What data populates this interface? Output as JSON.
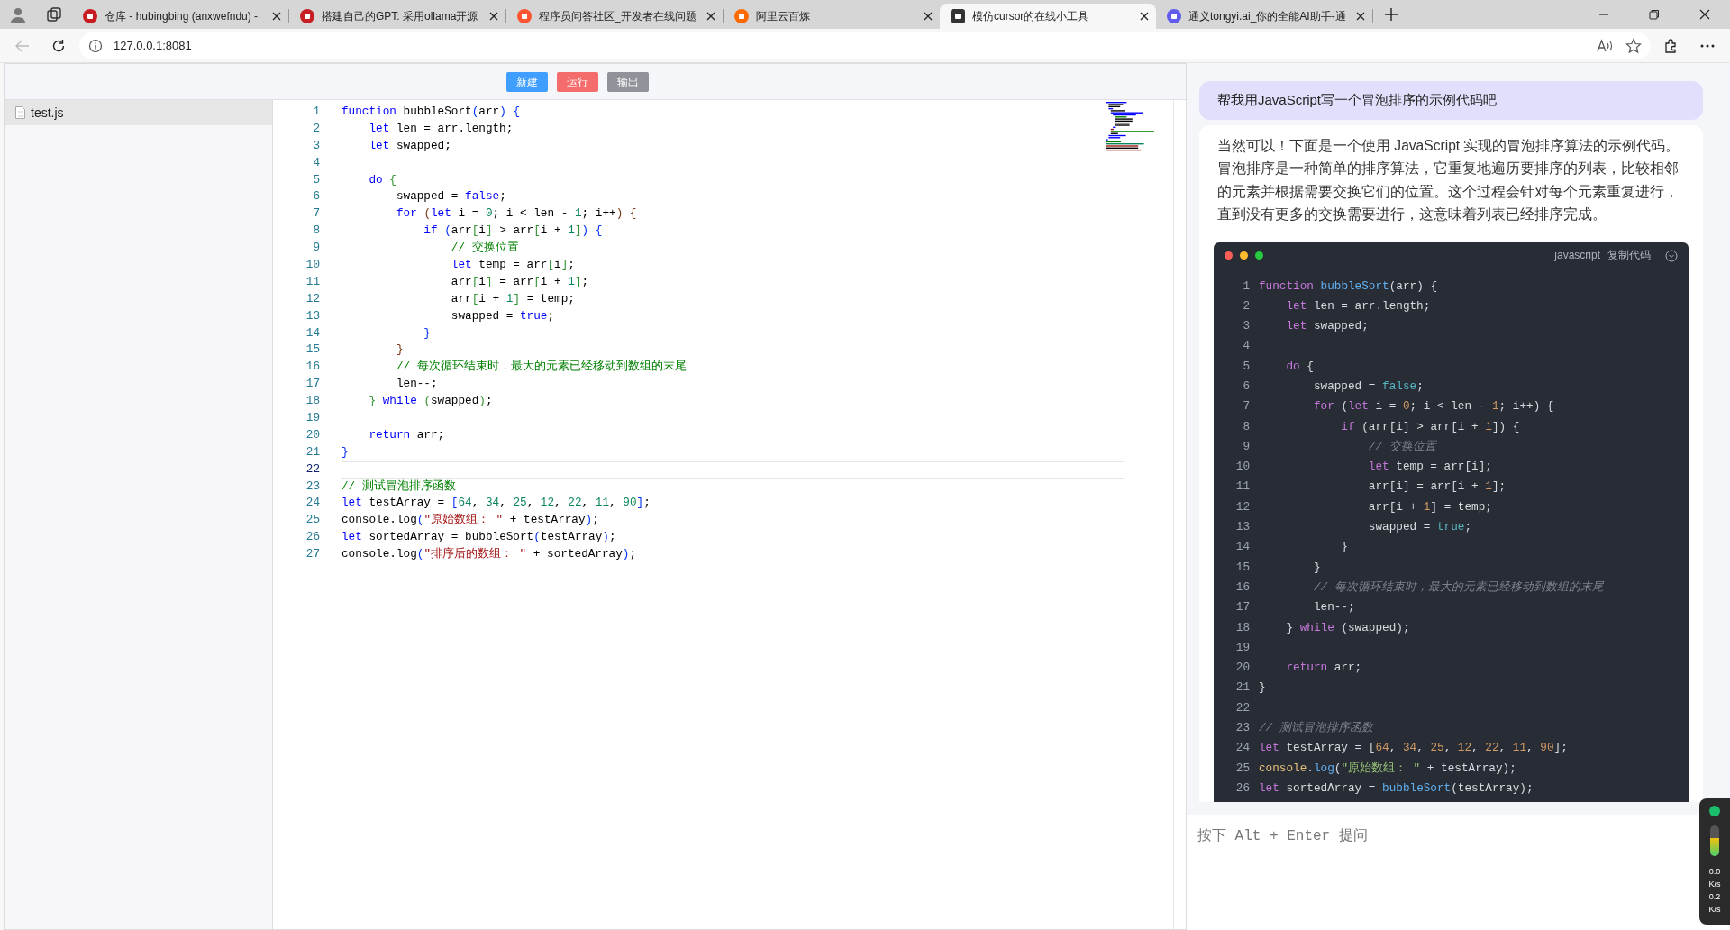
{
  "browser": {
    "tabs": [
      {
        "title": "仓库 - hubingbing (anxwefndu) -",
        "color": "#c71d23",
        "selected": false
      },
      {
        "title": "搭建自己的GPT: 采用ollama开源",
        "color": "#c71d23",
        "selected": false
      },
      {
        "title": "程序员问答社区_开发者在线问题",
        "color": "#fc5531",
        "selected": false
      },
      {
        "title": "阿里云百炼",
        "color": "#ff6a00",
        "selected": false
      },
      {
        "title": "模仿cursor的在线小工具",
        "color": "#333333",
        "selected": true
      },
      {
        "title": "通义tongyi.ai_你的全能AI助手-通",
        "color": "#615ced",
        "selected": false
      }
    ],
    "url": "127.0.0.1:8081"
  },
  "toolbar": {
    "buttons": [
      {
        "label": "新建",
        "color": "#409eff"
      },
      {
        "label": "运行",
        "color": "#f56c6c"
      },
      {
        "label": "输出",
        "color": "#909399"
      }
    ]
  },
  "files": [
    {
      "name": "test.js",
      "selected": true
    }
  ],
  "editor": {
    "lines": [
      {
        "n": "1",
        "current": false,
        "code": [
          {
            "kind": "kw",
            "text": "function"
          },
          {
            "kind": "id",
            "text": " bubbleSort"
          },
          {
            "kind": "br1",
            "text": "("
          },
          {
            "kind": "id",
            "text": "arr"
          },
          {
            "kind": "br1",
            "text": ")"
          },
          {
            "kind": "br1",
            "text": " {"
          }
        ]
      },
      {
        "n": "2",
        "current": false,
        "code": [
          {
            "kind": "kw",
            "text": "    let"
          },
          {
            "kind": "id",
            "text": " len = arr.length;"
          }
        ]
      },
      {
        "n": "3",
        "current": false,
        "code": [
          {
            "kind": "kw",
            "text": "    let"
          },
          {
            "kind": "id",
            "text": " swapped;"
          }
        ]
      },
      {
        "n": "4",
        "current": false
      },
      {
        "n": "5",
        "current": false,
        "code": [
          {
            "kind": "kw",
            "text": "    do"
          },
          {
            "kind": "br2",
            "text": " {"
          }
        ]
      },
      {
        "n": "6",
        "current": false,
        "code": [
          {
            "kind": "id",
            "text": "        swapped = "
          },
          {
            "kind": "kw",
            "text": "false"
          },
          {
            "kind": "id",
            "text": ";"
          }
        ]
      },
      {
        "n": "7",
        "current": false,
        "code": [
          {
            "kind": "kw",
            "text": "        for"
          },
          {
            "kind": "br3",
            "text": " ("
          },
          {
            "kind": "kw",
            "text": "let"
          },
          {
            "kind": "id",
            "text": " i = "
          },
          {
            "kind": "num",
            "text": "0"
          },
          {
            "kind": "id",
            "text": "; i < len - "
          },
          {
            "kind": "num",
            "text": "1"
          },
          {
            "kind": "id",
            "text": "; i++"
          },
          {
            "kind": "br3",
            "text": ")"
          },
          {
            "kind": "br3",
            "text": " {"
          }
        ]
      },
      {
        "n": "8",
        "current": false,
        "code": [
          {
            "kind": "kw",
            "text": "            if"
          },
          {
            "kind": "br1",
            "text": " ("
          },
          {
            "kind": "id",
            "text": "arr"
          },
          {
            "kind": "br2",
            "text": "["
          },
          {
            "kind": "id",
            "text": "i"
          },
          {
            "kind": "br2",
            "text": "]"
          },
          {
            "kind": "id",
            "text": " > arr"
          },
          {
            "kind": "br2",
            "text": "["
          },
          {
            "kind": "id",
            "text": "i + "
          },
          {
            "kind": "num",
            "text": "1"
          },
          {
            "kind": "br2",
            "text": "]"
          },
          {
            "kind": "br1",
            "text": ")"
          },
          {
            "kind": "br1",
            "text": " {"
          }
        ]
      },
      {
        "n": "9",
        "current": false,
        "code": [
          {
            "kind": "com",
            "text": "                // 交换位置"
          }
        ]
      },
      {
        "n": "10",
        "current": false,
        "code": [
          {
            "kind": "kw",
            "text": "                let"
          },
          {
            "kind": "id",
            "text": " temp = arr"
          },
          {
            "kind": "br2",
            "text": "["
          },
          {
            "kind": "id",
            "text": "i"
          },
          {
            "kind": "br2",
            "text": "]"
          },
          {
            "kind": "id",
            "text": ";"
          }
        ]
      },
      {
        "n": "11",
        "current": false,
        "code": [
          {
            "kind": "id",
            "text": "                arr"
          },
          {
            "kind": "br2",
            "text": "["
          },
          {
            "kind": "id",
            "text": "i"
          },
          {
            "kind": "br2",
            "text": "]"
          },
          {
            "kind": "id",
            "text": " = arr"
          },
          {
            "kind": "br2",
            "text": "["
          },
          {
            "kind": "id",
            "text": "i + "
          },
          {
            "kind": "num",
            "text": "1"
          },
          {
            "kind": "br2",
            "text": "]"
          },
          {
            "kind": "id",
            "text": ";"
          }
        ]
      },
      {
        "n": "12",
        "current": false,
        "code": [
          {
            "kind": "id",
            "text": "                arr"
          },
          {
            "kind": "br2",
            "text": "["
          },
          {
            "kind": "id",
            "text": "i + "
          },
          {
            "kind": "num",
            "text": "1"
          },
          {
            "kind": "br2",
            "text": "]"
          },
          {
            "kind": "id",
            "text": " = temp;"
          }
        ]
      },
      {
        "n": "13",
        "current": false,
        "code": [
          {
            "kind": "id",
            "text": "                swapped = "
          },
          {
            "kind": "kw",
            "text": "true"
          },
          {
            "kind": "id",
            "text": ";"
          }
        ]
      },
      {
        "n": "14",
        "current": false,
        "code": [
          {
            "kind": "br1",
            "text": "            }"
          }
        ]
      },
      {
        "n": "15",
        "current": false,
        "code": [
          {
            "kind": "br3",
            "text": "        }"
          }
        ]
      },
      {
        "n": "16",
        "current": false,
        "code": [
          {
            "kind": "com",
            "text": "        // 每次循环结束时，最大的元素已经移动到数组的末尾"
          }
        ]
      },
      {
        "n": "17",
        "current": false,
        "code": [
          {
            "kind": "id",
            "text": "        len--;"
          }
        ]
      },
      {
        "n": "18",
        "current": false,
        "code": [
          {
            "kind": "br2",
            "text": "    }"
          },
          {
            "kind": "kw",
            "text": " while"
          },
          {
            "kind": "br2",
            "text": " ("
          },
          {
            "kind": "id",
            "text": "swapped"
          },
          {
            "kind": "br2",
            "text": ")"
          },
          {
            "kind": "id",
            "text": ";"
          }
        ]
      },
      {
        "n": "19",
        "current": false
      },
      {
        "n": "20",
        "current": false,
        "code": [
          {
            "kind": "kw",
            "text": "    return"
          },
          {
            "kind": "id",
            "text": " arr;"
          }
        ]
      },
      {
        "n": "21",
        "current": false,
        "code": [
          {
            "kind": "br1",
            "text": "}"
          }
        ]
      },
      {
        "n": "22",
        "current": true
      },
      {
        "n": "23",
        "current": false,
        "code": [
          {
            "kind": "com",
            "text": "// 测试冒泡排序函数"
          }
        ]
      },
      {
        "n": "24",
        "current": false,
        "code": [
          {
            "kind": "kw",
            "text": "let"
          },
          {
            "kind": "id",
            "text": " testArray = "
          },
          {
            "kind": "br1",
            "text": "["
          },
          {
            "kind": "num",
            "text": "64"
          },
          {
            "kind": "id",
            "text": ", "
          },
          {
            "kind": "num",
            "text": "34"
          },
          {
            "kind": "id",
            "text": ", "
          },
          {
            "kind": "num",
            "text": "25"
          },
          {
            "kind": "id",
            "text": ", "
          },
          {
            "kind": "num",
            "text": "12"
          },
          {
            "kind": "id",
            "text": ", "
          },
          {
            "kind": "num",
            "text": "22"
          },
          {
            "kind": "id",
            "text": ", "
          },
          {
            "kind": "num",
            "text": "11"
          },
          {
            "kind": "id",
            "text": ", "
          },
          {
            "kind": "num",
            "text": "90"
          },
          {
            "kind": "br1",
            "text": "]"
          },
          {
            "kind": "id",
            "text": ";"
          }
        ]
      },
      {
        "n": "25",
        "current": false,
        "code": [
          {
            "kind": "id",
            "text": "console.log"
          },
          {
            "kind": "br1",
            "text": "("
          },
          {
            "kind": "str",
            "text": "\"原始数组： \""
          },
          {
            "kind": "id",
            "text": " + testArray"
          },
          {
            "kind": "br1",
            "text": ")"
          },
          {
            "kind": "id",
            "text": ";"
          }
        ]
      },
      {
        "n": "26",
        "current": false,
        "code": [
          {
            "kind": "kw",
            "text": "let"
          },
          {
            "kind": "id",
            "text": " sortedArray = "
          },
          {
            "kind": "id",
            "text": "bubbleSort"
          },
          {
            "kind": "br1",
            "text": "("
          },
          {
            "kind": "id",
            "text": "testArray"
          },
          {
            "kind": "br1",
            "text": ")"
          },
          {
            "kind": "id",
            "text": ";"
          }
        ]
      },
      {
        "n": "27",
        "current": false,
        "code": [
          {
            "kind": "id",
            "text": "console.log"
          },
          {
            "kind": "br1",
            "text": "("
          },
          {
            "kind": "str",
            "text": "\"排序后的数组： \""
          },
          {
            "kind": "id",
            "text": " + sortedArray"
          },
          {
            "kind": "br1",
            "text": ")"
          },
          {
            "kind": "id",
            "text": ";"
          }
        ]
      }
    ]
  },
  "chat": {
    "messages": [
      {
        "kind": "user",
        "text": "帮我用JavaScript写一个冒泡排序的示例代码吧"
      },
      {
        "kind": "assistant",
        "text": "当然可以！下面是一个使用 JavaScript 实现的冒泡排序算法的示例代码。冒泡排序是一种简单的排序算法，它重复地遍历要排序的列表，比较相邻的元素并根据需要交换它们的位置。这个过程会针对每个元素重复进行，直到没有更多的交换需要进行，这意味着列表已经排序完成。",
        "code": {
          "language": "javascript",
          "copy_label": "复制代码",
          "lines": [
            {
              "n": "1",
              "code": [
                {
                  "kind": "kw",
                  "text": "function"
                },
                {
                  "kind": "fn",
                  "text": " bubbleSort"
                },
                {
                  "kind": "id",
                  "text": "("
                },
                {
                  "kind": "id",
                  "text": "arr"
                },
                {
                  "kind": "id",
                  "text": ")"
                },
                {
                  "kind": "id",
                  "text": " {"
                }
              ]
            },
            {
              "n": "2",
              "code": [
                {
                  "kind": "kw",
                  "text": "    let"
                },
                {
                  "kind": "id",
                  "text": " len = arr.length;"
                }
              ]
            },
            {
              "n": "3",
              "code": [
                {
                  "kind": "kw",
                  "text": "    let"
                },
                {
                  "kind": "id",
                  "text": " swapped;"
                }
              ]
            },
            {
              "n": "4"
            },
            {
              "n": "5",
              "code": [
                {
                  "kind": "kw",
                  "text": "    do"
                },
                {
                  "kind": "id",
                  "text": " {"
                }
              ]
            },
            {
              "n": "6",
              "code": [
                {
                  "kind": "id",
                  "text": "        swapped = "
                },
                {
                  "kind": "bool",
                  "text": "false"
                },
                {
                  "kind": "id",
                  "text": ";"
                }
              ]
            },
            {
              "n": "7",
              "code": [
                {
                  "kind": "kw",
                  "text": "        for"
                },
                {
                  "kind": "id",
                  "text": " ("
                },
                {
                  "kind": "kw",
                  "text": "let"
                },
                {
                  "kind": "id",
                  "text": " i = "
                },
                {
                  "kind": "num",
                  "text": "0"
                },
                {
                  "kind": "id",
                  "text": "; i < len - "
                },
                {
                  "kind": "num",
                  "text": "1"
                },
                {
                  "kind": "id",
                  "text": "; i++"
                },
                {
                  "kind": "id",
                  "text": ")"
                },
                {
                  "kind": "id",
                  "text": " {"
                }
              ]
            },
            {
              "n": "8",
              "code": [
                {
                  "kind": "kw",
                  "text": "            if"
                },
                {
                  "kind": "id",
                  "text": " ("
                },
                {
                  "kind": "id",
                  "text": "arr"
                },
                {
                  "kind": "id",
                  "text": "["
                },
                {
                  "kind": "id",
                  "text": "i"
                },
                {
                  "kind": "id",
                  "text": "]"
                },
                {
                  "kind": "id",
                  "text": " > arr"
                },
                {
                  "kind": "id",
                  "text": "["
                },
                {
                  "kind": "id",
                  "text": "i + "
                },
                {
                  "kind": "num",
                  "text": "1"
                },
                {
                  "kind": "id",
                  "text": "]"
                },
                {
                  "kind": "id",
                  "text": ")"
                },
                {
                  "kind": "id",
                  "text": " {"
                }
              ]
            },
            {
              "n": "9",
              "code": [
                {
                  "kind": "com",
                  "text": "                // 交换位置"
                }
              ]
            },
            {
              "n": "10",
              "code": [
                {
                  "kind": "kw",
                  "text": "                let"
                },
                {
                  "kind": "id",
                  "text": " temp = arr"
                },
                {
                  "kind": "id",
                  "text": "["
                },
                {
                  "kind": "id",
                  "text": "i"
                },
                {
                  "kind": "id",
                  "text": "]"
                },
                {
                  "kind": "id",
                  "text": ";"
                }
              ]
            },
            {
              "n": "11",
              "code": [
                {
                  "kind": "id",
                  "text": "                arr"
                },
                {
                  "kind": "id",
                  "text": "["
                },
                {
                  "kind": "id",
                  "text": "i"
                },
                {
                  "kind": "id",
                  "text": "]"
                },
                {
                  "kind": "id",
                  "text": " = arr"
                },
                {
                  "kind": "id",
                  "text": "["
                },
                {
                  "kind": "id",
                  "text": "i + "
                },
                {
                  "kind": "num",
                  "text": "1"
                },
                {
                  "kind": "id",
                  "text": "]"
                },
                {
                  "kind": "id",
                  "text": ";"
                }
              ]
            },
            {
              "n": "12",
              "code": [
                {
                  "kind": "id",
                  "text": "                arr"
                },
                {
                  "kind": "id",
                  "text": "["
                },
                {
                  "kind": "id",
                  "text": "i + "
                },
                {
                  "kind": "num",
                  "text": "1"
                },
                {
                  "kind": "id",
                  "text": "]"
                },
                {
                  "kind": "id",
                  "text": " = temp;"
                }
              ]
            },
            {
              "n": "13",
              "code": [
                {
                  "kind": "id",
                  "text": "                swapped = "
                },
                {
                  "kind": "bool",
                  "text": "true"
                },
                {
                  "kind": "id",
                  "text": ";"
                }
              ]
            },
            {
              "n": "14",
              "code": [
                {
                  "kind": "id",
                  "text": "            }"
                }
              ]
            },
            {
              "n": "15",
              "code": [
                {
                  "kind": "id",
                  "text": "        }"
                }
              ]
            },
            {
              "n": "16",
              "code": [
                {
                  "kind": "com",
                  "text": "        // 每次循环结束时，最大的元素已经移动到数组的末尾"
                }
              ]
            },
            {
              "n": "17",
              "code": [
                {
                  "kind": "id",
                  "text": "        len--;"
                }
              ]
            },
            {
              "n": "18",
              "code": [
                {
                  "kind": "id",
                  "text": "    }"
                },
                {
                  "kind": "kw",
                  "text": " while"
                },
                {
                  "kind": "id",
                  "text": " ("
                },
                {
                  "kind": "id",
                  "text": "swapped"
                },
                {
                  "kind": "id",
                  "text": ")"
                },
                {
                  "kind": "id",
                  "text": ";"
                }
              ]
            },
            {
              "n": "19"
            },
            {
              "n": "20",
              "code": [
                {
                  "kind": "kw",
                  "text": "    return"
                },
                {
                  "kind": "id",
                  "text": " arr;"
                }
              ]
            },
            {
              "n": "21",
              "code": [
                {
                  "kind": "id",
                  "text": "}"
                }
              ]
            },
            {
              "n": "22"
            },
            {
              "n": "23",
              "code": [
                {
                  "kind": "com",
                  "text": "// 测试冒泡排序函数"
                }
              ]
            },
            {
              "n": "24",
              "code": [
                {
                  "kind": "kw",
                  "text": "let"
                },
                {
                  "kind": "id",
                  "text": " testArray = "
                },
                {
                  "kind": "id",
                  "text": "["
                },
                {
                  "kind": "num",
                  "text": "64"
                },
                {
                  "kind": "id",
                  "text": ", "
                },
                {
                  "kind": "num",
                  "text": "34"
                },
                {
                  "kind": "id",
                  "text": ", "
                },
                {
                  "kind": "num",
                  "text": "25"
                },
                {
                  "kind": "id",
                  "text": ", "
                },
                {
                  "kind": "num",
                  "text": "12"
                },
                {
                  "kind": "id",
                  "text": ", "
                },
                {
                  "kind": "num",
                  "text": "22"
                },
                {
                  "kind": "id",
                  "text": ", "
                },
                {
                  "kind": "num",
                  "text": "11"
                },
                {
                  "kind": "id",
                  "text": ", "
                },
                {
                  "kind": "num",
                  "text": "90"
                },
                {
                  "kind": "id",
                  "text": "]"
                },
                {
                  "kind": "id",
                  "text": ";"
                }
              ]
            },
            {
              "n": "25",
              "code": [
                {
                  "kind": "obj",
                  "text": "console"
                },
                {
                  "kind": "id",
                  "text": "."
                },
                {
                  "kind": "fn",
                  "text": "log"
                },
                {
                  "kind": "id",
                  "text": "("
                },
                {
                  "kind": "str",
                  "text": "\"原始数组： \""
                },
                {
                  "kind": "id",
                  "text": " + testArray"
                },
                {
                  "kind": "id",
                  "text": ")"
                },
                {
                  "kind": "id",
                  "text": ";"
                }
              ]
            },
            {
              "n": "26",
              "code": [
                {
                  "kind": "kw",
                  "text": "let"
                },
                {
                  "kind": "id",
                  "text": " sortedArray = "
                },
                {
                  "kind": "fn",
                  "text": "bubbleSort"
                },
                {
                  "kind": "id",
                  "text": "("
                },
                {
                  "kind": "id",
                  "text": "testArray"
                },
                {
                  "kind": "id",
                  "text": ")"
                },
                {
                  "kind": "id",
                  "text": ";"
                }
              ]
            }
          ]
        }
      }
    ],
    "input": {
      "placeholder": "按下 Alt + Enter 提问"
    }
  },
  "speed_widget": {
    "level": 0.6,
    "upload": "0.0",
    "upload_unit": "K/s",
    "download": "0.2",
    "download_unit": "K/s"
  }
}
